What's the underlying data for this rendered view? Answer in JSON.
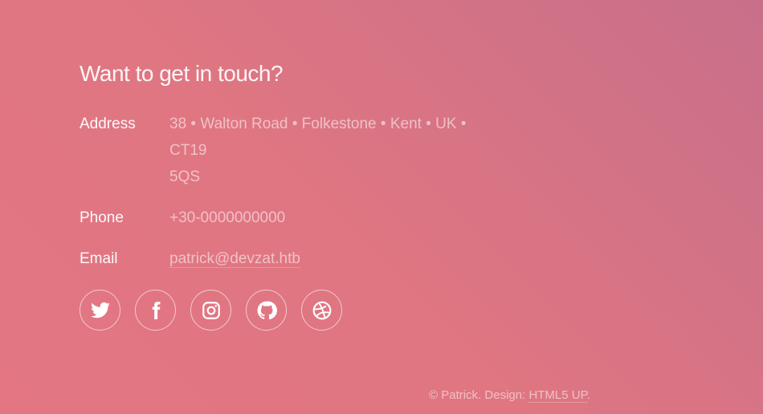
{
  "contact": {
    "title": "Want to get in touch?",
    "address_label": "Address",
    "address_line1": "38 • Walton Road • Folkestone • Kent • UK • CT19",
    "address_line2": "5QS",
    "phone_label": "Phone",
    "phone_value": "+30-0000000000",
    "email_label": "Email",
    "email_value": "patrick@devzat.htb"
  },
  "socials": [
    {
      "icon": "twitter-icon"
    },
    {
      "icon": "facebook-icon"
    },
    {
      "icon": "instagram-icon"
    },
    {
      "icon": "github-icon"
    },
    {
      "icon": "dribbble-icon"
    }
  ],
  "footer": {
    "copyright_prefix": "© Patrick. Design: ",
    "design_link": "HTML5 UP",
    "period": "."
  },
  "colors": {
    "gradient_start": "#e37682",
    "gradient_end": "#c86f8a",
    "text": "#ffffff"
  }
}
